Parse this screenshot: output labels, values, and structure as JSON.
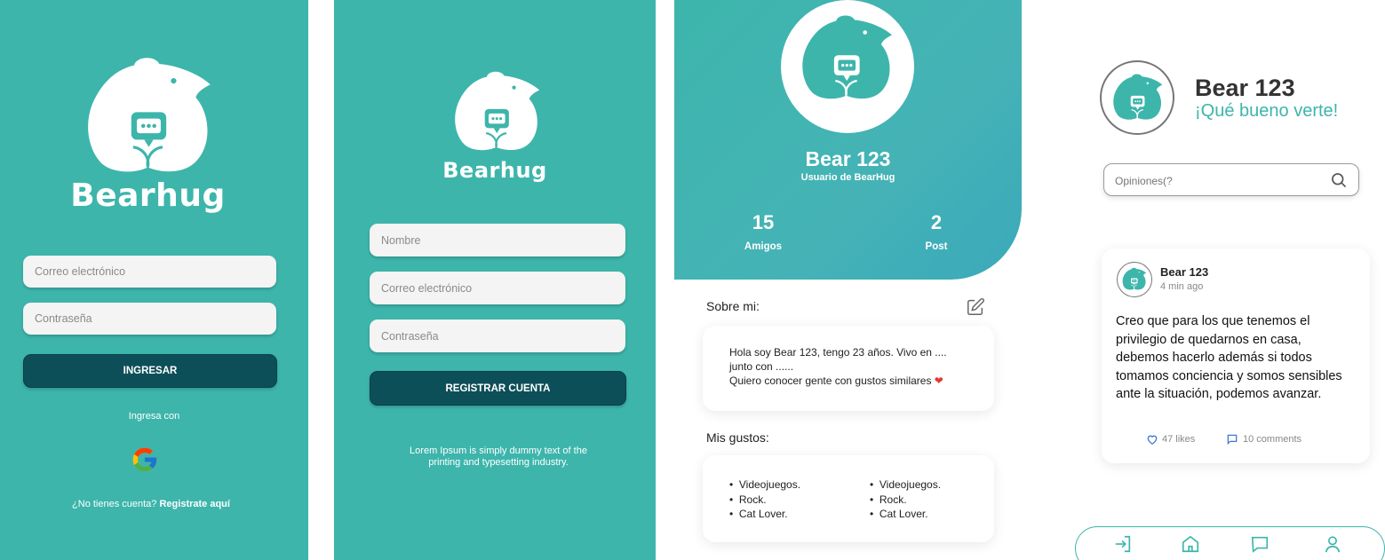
{
  "screens": {
    "login": {
      "brand": "Bearhug",
      "email_placeholder": "Correo electrónico",
      "password_placeholder": "Contraseña",
      "submit_label": "INGRESAR",
      "login_with": "Ingresa con",
      "no_account": "¿No tienes cuenta?",
      "register_link": "Registrate aquí"
    },
    "register": {
      "brand": "Bearhug",
      "name_placeholder": "Nombre",
      "email_placeholder": "Correo electrónico",
      "password_placeholder": "Contraseña",
      "submit_label": "REGISTRAR CUENTA",
      "footer_line1": "Lorem Ipsum is simply dummy text of the",
      "footer_line2": "printing and typesetting industry."
    },
    "profile": {
      "name": "Bear 123",
      "subtitle": "Usuario de BearHug",
      "friends_count": "15",
      "friends_label": "Amigos",
      "posts_count": "2",
      "posts_label": "Post",
      "about_title": "Sobre mi:",
      "about_line1": "Hola soy Bear 123, tengo 23 años. Vivo en ....",
      "about_line2": "junto con ......",
      "about_line3": "Quiero conocer gente con gustos similares",
      "likes_title": "Mis gustos:",
      "likes_col1": [
        "Videojuegos.",
        "Rock.",
        "Cat Lover."
      ],
      "likes_col2": [
        "Videojuegos.",
        "Rock.",
        "Cat Lover."
      ]
    },
    "feed": {
      "user_name": "Bear 123",
      "greeting": "¡Qué bueno verte!",
      "search_placeholder": "Opiniones(?",
      "post_author": "Bear 123",
      "post_time": "4 min ago",
      "post_text": "Creo que para los que tenemos el privilegio de quedarnos en casa, debemos hacerlo además si todos tomamos conciencia y somos sensibles ante la situación, podemos avanzar.",
      "likes": "47 likes",
      "comments": "10 comments"
    }
  },
  "colors": {
    "teal": "#3db5ab",
    "dark_teal": "#0d4f58",
    "accent_text": "#3db5ab"
  },
  "icons": [
    "bear-logo-icon",
    "chat-bubble-icon",
    "google-icon",
    "edit-icon",
    "heart-icon",
    "search-icon",
    "comment-icon",
    "login-icon",
    "home-icon",
    "message-icon",
    "user-icon"
  ]
}
